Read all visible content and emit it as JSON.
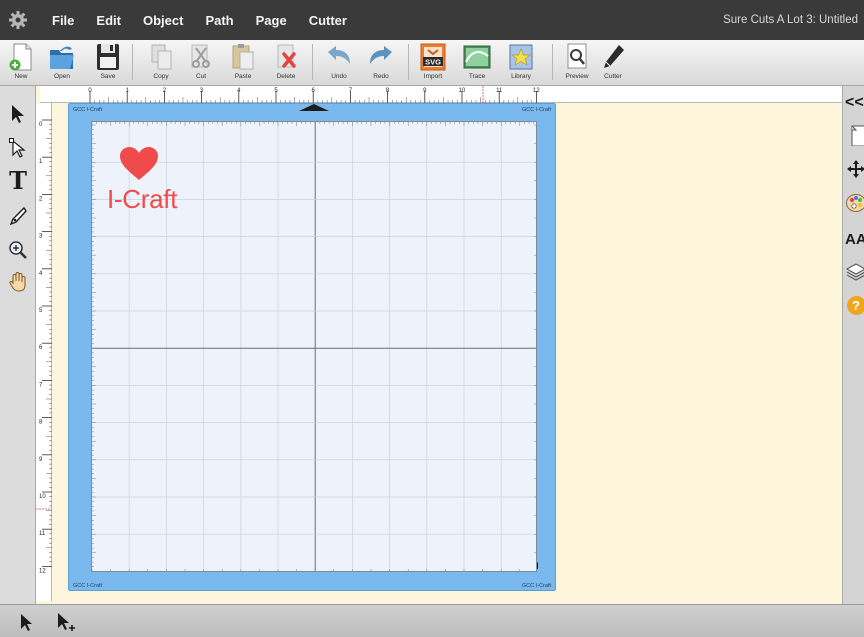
{
  "menubar": {
    "gear_icon": "gear-icon",
    "items": [
      "File",
      "Edit",
      "Object",
      "Path",
      "Page",
      "Cutter"
    ],
    "app_title": "Sure Cuts A Lot 3: Untitled"
  },
  "toolbar": {
    "buttons": [
      {
        "label": "New",
        "icon": "new-document-icon"
      },
      {
        "label": "Open",
        "icon": "open-folder-icon"
      },
      {
        "label": "Save",
        "icon": "floppy-disk-icon"
      },
      {
        "label": "Copy",
        "icon": "copy-icon"
      },
      {
        "label": "Cut",
        "icon": "scissors-icon"
      },
      {
        "label": "Paste",
        "icon": "paste-clipboard-icon"
      },
      {
        "label": "Delete",
        "icon": "delete-icon"
      },
      {
        "label": "Undo",
        "icon": "undo-arrow-icon"
      },
      {
        "label": "Redo",
        "icon": "redo-arrow-icon"
      },
      {
        "label": "Import",
        "icon": "import-svg-icon"
      },
      {
        "label": "Trace",
        "icon": "trace-image-icon"
      },
      {
        "label": "Library",
        "icon": "library-star-icon"
      },
      {
        "label": "Preview",
        "icon": "magnifier-preview-icon"
      },
      {
        "label": "Cutter",
        "icon": "pen-cutter-icon"
      }
    ],
    "svg_badge": "SVG"
  },
  "ruler_top": {
    "ticks": [
      "0",
      "1",
      "2",
      "3",
      "4",
      "5",
      "6",
      "7",
      "8",
      "9",
      "10",
      "11",
      "12"
    ]
  },
  "ruler_left": {
    "ticks": [
      "0",
      "1",
      "2",
      "3",
      "4",
      "5",
      "6",
      "7",
      "8",
      "9",
      "10",
      "11",
      "12"
    ]
  },
  "left_tools": [
    {
      "name": "select-arrow-icon"
    },
    {
      "name": "node-edit-icon"
    },
    {
      "name": "text-tool-icon",
      "glyph": "T"
    },
    {
      "name": "pen-tool-icon"
    },
    {
      "name": "zoom-icon"
    },
    {
      "name": "hand-pan-icon"
    }
  ],
  "right_panel": [
    {
      "name": "collapse-panel-icon"
    },
    {
      "name": "page-icon"
    },
    {
      "name": "move-icon"
    },
    {
      "name": "color-palette-icon"
    },
    {
      "name": "font-size-icon",
      "glyph": "AA"
    },
    {
      "name": "layers-icon"
    },
    {
      "name": "help-icon",
      "glyph": "?"
    }
  ],
  "mat": {
    "brand_labels": [
      "GCC I-Craft",
      "GCC I-Craft",
      "GCC I-Craft",
      "GCC I-Craft"
    ],
    "color": "#7ab9ed"
  },
  "design": {
    "text": "I-Craft",
    "text_color": "#ef4b4b",
    "shape": "heart-shape"
  },
  "bottombar": [
    {
      "name": "select-tool-icon"
    },
    {
      "name": "add-select-tool-icon"
    }
  ]
}
